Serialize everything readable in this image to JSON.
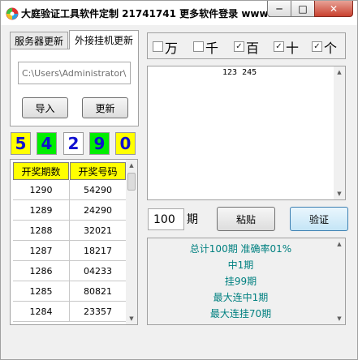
{
  "window": {
    "title": "大庭验证工具软件定制 21741741 更多软件登录 www....",
    "minimize_glyph": "─",
    "maximize_glyph": "□",
    "close_glyph": "✕"
  },
  "tabs": [
    {
      "label": "服务器更新",
      "active": false
    },
    {
      "label": "外接挂机更新",
      "active": true
    }
  ],
  "path_value": "C:\\Users\\Administrator\\",
  "buttons": {
    "import": "导入",
    "update": "更新",
    "paste": "粘贴",
    "verify": "验证"
  },
  "digits": [
    {
      "value": "5",
      "bg": "#ffff00"
    },
    {
      "value": "4",
      "bg": "#00ee00"
    },
    {
      "value": "2",
      "bg": "#ffffff"
    },
    {
      "value": "9",
      "bg": "#00ee00"
    },
    {
      "value": "0",
      "bg": "#ffff00"
    }
  ],
  "table": {
    "headers": [
      "开奖期数",
      "开奖号码"
    ],
    "rows": [
      [
        "1290",
        "54290"
      ],
      [
        "1289",
        "24290"
      ],
      [
        "1288",
        "32021"
      ],
      [
        "1287",
        "18217"
      ],
      [
        "1286",
        "04233"
      ],
      [
        "1285",
        "80821"
      ],
      [
        "1284",
        "23357"
      ]
    ]
  },
  "checkboxes": [
    {
      "label": "万",
      "checked": false
    },
    {
      "label": "千",
      "checked": false
    },
    {
      "label": "百",
      "checked": true
    },
    {
      "label": "十",
      "checked": true
    },
    {
      "label": "个",
      "checked": true
    }
  ],
  "textarea_value": "123 245",
  "period": {
    "value": "100",
    "label": "期"
  },
  "results": [
    "总计100期   准确率01%",
    "中1期",
    "挂99期",
    "最大连中1期",
    "最大连挂70期"
  ],
  "colors": {
    "result_text": "#008080",
    "table_header": "#ffff00",
    "digit_text": "#1010d0"
  }
}
